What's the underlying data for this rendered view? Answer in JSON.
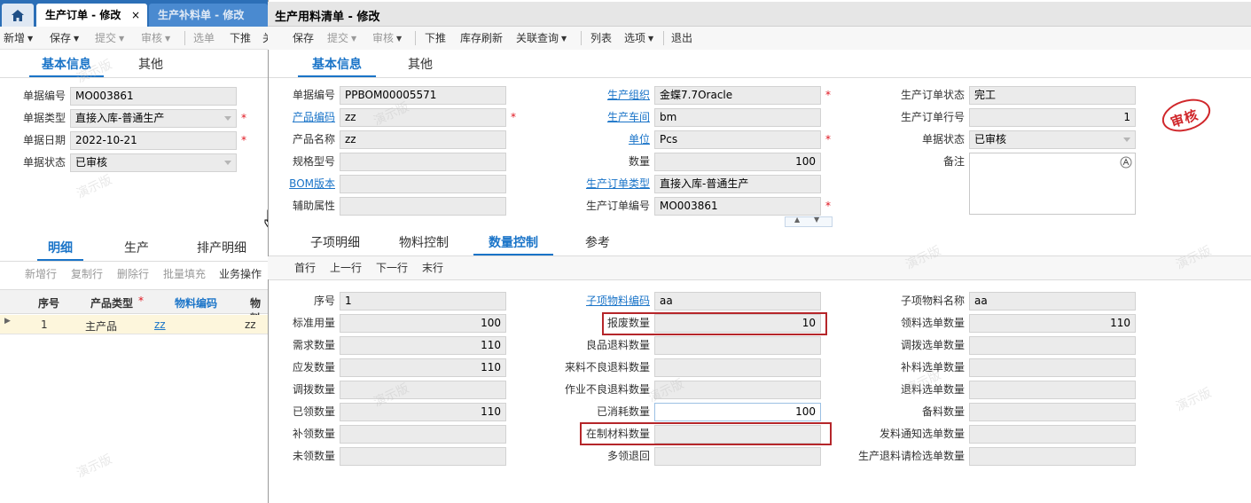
{
  "tabs": {
    "home_icon": "home-icon",
    "active_label": "生产订单 - 修改",
    "active_close": "×",
    "inactive_label": "生产补料单 - 修改"
  },
  "bg": {
    "toolbar": [
      "新增",
      "保存",
      "提交",
      "审核",
      "选单",
      "下推",
      "关"
    ],
    "tabs": [
      "基本信息",
      "其他"
    ],
    "labels": {
      "bill_no": "单据编号",
      "bill_type": "单据类型",
      "bill_date": "单据日期",
      "bill_status": "单据状态"
    },
    "values": {
      "bill_no": "MO003861",
      "bill_type": "直接入库-普通生产",
      "bill_date": "2022-10-21",
      "bill_status": "已审核"
    },
    "detail_tabs": [
      "明细",
      "生产",
      "排产明细"
    ],
    "grid_toolbar": [
      "新增行",
      "复制行",
      "删除行",
      "批量填充",
      "业务操作"
    ],
    "grid_headers": [
      "序号",
      "产品类型",
      "物料编码",
      "物料"
    ],
    "grid_row": {
      "seq": "1",
      "type": "主产品",
      "code": "zz",
      "name": "zz"
    }
  },
  "dialog": {
    "title": "生产用料清单 - 修改",
    "toolbar": [
      "保存",
      "提交",
      "审核",
      "下推",
      "库存刷新",
      "关联查询",
      "列表",
      "选项",
      "退出"
    ],
    "tabs": [
      "基本信息",
      "其他"
    ],
    "stamp": "审核",
    "header": {
      "col1": [
        {
          "label": "单据编号",
          "value": "PPBOM00005571"
        },
        {
          "label": "产品编码",
          "value": "zz"
        },
        {
          "label": "产品名称",
          "value": "zz"
        },
        {
          "label": "规格型号",
          "value": ""
        },
        {
          "label": "BOM版本",
          "value": ""
        },
        {
          "label": "辅助属性",
          "value": ""
        }
      ],
      "col2": [
        {
          "label": "生产组织",
          "value": "金蝶7.7Oracle"
        },
        {
          "label": "生产车间",
          "value": "bm"
        },
        {
          "label": "单位",
          "value": "Pcs"
        },
        {
          "label": "数量",
          "value": "100"
        },
        {
          "label": "生产订单类型",
          "value": "直接入库-普通生产"
        },
        {
          "label": "生产订单编号",
          "value": "MO003861"
        }
      ],
      "col3": [
        {
          "label": "生产订单状态",
          "value": "完工"
        },
        {
          "label": "生产订单行号",
          "value": "1"
        },
        {
          "label": "单据状态",
          "value": "已审核"
        },
        {
          "label": "备注",
          "value": ""
        }
      ]
    },
    "subtabs": [
      "子项明细",
      "物料控制",
      "数量控制",
      "参考"
    ],
    "nav": [
      "首行",
      "上一行",
      "下一行",
      "末行"
    ],
    "qty": {
      "col1": [
        {
          "label": "序号",
          "value": "1"
        },
        {
          "label": "标准用量",
          "value": "100"
        },
        {
          "label": "需求数量",
          "value": "110"
        },
        {
          "label": "应发数量",
          "value": "110"
        },
        {
          "label": "调拨数量",
          "value": ""
        },
        {
          "label": "已领数量",
          "value": "110"
        },
        {
          "label": "补领数量",
          "value": ""
        },
        {
          "label": "未领数量",
          "value": ""
        }
      ],
      "col2": [
        {
          "label": "子项物料编码",
          "value": "aa"
        },
        {
          "label": "报废数量",
          "value": "10"
        },
        {
          "label": "良品退料数量",
          "value": ""
        },
        {
          "label": "来料不良退料数量",
          "value": ""
        },
        {
          "label": "作业不良退料数量",
          "value": ""
        },
        {
          "label": "已消耗数量",
          "value": "100"
        },
        {
          "label": "在制材料数量",
          "value": ""
        },
        {
          "label": "多领退回",
          "value": ""
        }
      ],
      "col3": [
        {
          "label": "子项物料名称",
          "value": "aa"
        },
        {
          "label": "领料选单数量",
          "value": "110"
        },
        {
          "label": "调拨选单数量",
          "value": ""
        },
        {
          "label": "补料选单数量",
          "value": ""
        },
        {
          "label": "退料选单数量",
          "value": ""
        },
        {
          "label": "备料数量",
          "value": ""
        },
        {
          "label": "发料通知选单数量",
          "value": ""
        },
        {
          "label": "生产退料请检选单数量",
          "value": ""
        }
      ]
    }
  },
  "watermark": "演示版",
  "colors": {
    "accent": "#1a74c8",
    "tabbar": "#2c6fb7",
    "required": "#e0141e",
    "highlight": "#b5262a"
  }
}
